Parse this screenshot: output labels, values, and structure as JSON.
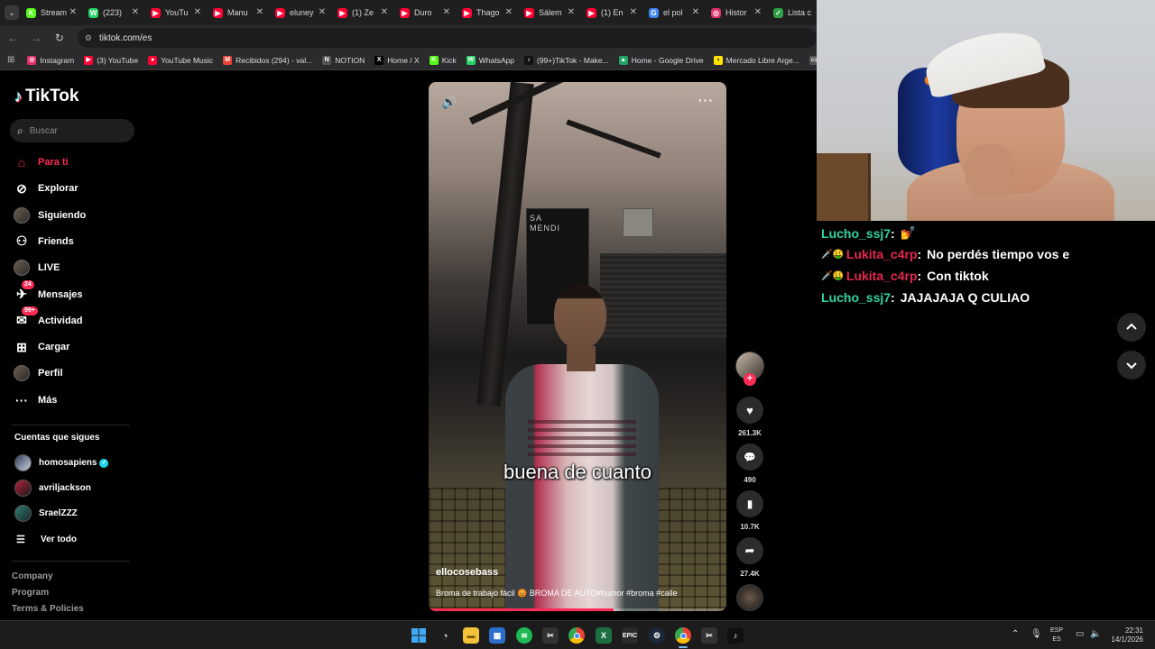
{
  "tabs": [
    {
      "title": "Stream",
      "fav": "K",
      "color": "#53fc18"
    },
    {
      "title": "(223)",
      "fav": "W",
      "color": "#25d366"
    },
    {
      "title": "YouTu",
      "fav": "▶",
      "color": "#ff0033"
    },
    {
      "title": "Manu",
      "fav": "▶",
      "color": "#ff0033"
    },
    {
      "title": "eluney",
      "fav": "▶",
      "color": "#ff0033"
    },
    {
      "title": "(1) Ze",
      "fav": "▶",
      "color": "#ff0033"
    },
    {
      "title": "Duro",
      "fav": "▶",
      "color": "#ff0033"
    },
    {
      "title": "Thago",
      "fav": "▶",
      "color": "#ff0033"
    },
    {
      "title": "Sálem",
      "fav": "▶",
      "color": "#ff0033"
    },
    {
      "title": "(1) En",
      "fav": "▶",
      "color": "#ff0033"
    },
    {
      "title": "el pol",
      "fav": "G",
      "color": "#4285f4"
    },
    {
      "title": "Histor",
      "fav": "◎",
      "color": "#e1306c"
    },
    {
      "title": "Lista c",
      "fav": "✓",
      "color": "#2ea043"
    }
  ],
  "address": {
    "url": "tiktok.com/es"
  },
  "bookmarks": [
    {
      "label": "Instagram",
      "icon": "◎",
      "color": "#e1306c"
    },
    {
      "label": "(3) YouTube",
      "icon": "▶",
      "color": "#ff0033"
    },
    {
      "label": "YouTube Music",
      "icon": "●",
      "color": "#ff0033"
    },
    {
      "label": "Recibidos (294) - val...",
      "icon": "M",
      "color": "#ea4335"
    },
    {
      "label": "NOTION",
      "icon": "N",
      "color": "#555555"
    },
    {
      "label": "Home / X",
      "icon": "X",
      "color": "#000000"
    },
    {
      "label": "Kick",
      "icon": "K",
      "color": "#53fc18"
    },
    {
      "label": "WhatsApp",
      "icon": "W",
      "color": "#25d366"
    },
    {
      "label": "(99+)TikTok - Make...",
      "icon": "♪",
      "color": "#111111"
    },
    {
      "label": "Home - Google Drive",
      "icon": "▲",
      "color": "#1fa463"
    },
    {
      "label": "Mercado Libre Arge...",
      "icon": "◑",
      "color": "#ffe600"
    },
    {
      "label": "PRO",
      "icon": "▭",
      "color": "#555555"
    }
  ],
  "tiktok": {
    "logo": "TikTok",
    "search_placeholder": "Buscar",
    "menu": [
      {
        "label": "Para ti",
        "icon": "home-icon",
        "active": true
      },
      {
        "label": "Explorar",
        "icon": "compass-icon"
      },
      {
        "label": "Siguiendo",
        "icon": "following-icon"
      },
      {
        "label": "Friends",
        "icon": "friends-icon"
      },
      {
        "label": "LIVE",
        "icon": "live-icon"
      },
      {
        "label": "Mensajes",
        "icon": "messages-icon",
        "badge": "24"
      },
      {
        "label": "Actividad",
        "icon": "activity-icon",
        "badge": "99+"
      },
      {
        "label": "Cargar",
        "icon": "upload-icon"
      },
      {
        "label": "Perfil",
        "icon": "profile-icon"
      },
      {
        "label": "Más",
        "icon": "more-icon"
      }
    ],
    "following_title": "Cuentas que sigues",
    "following": [
      {
        "name": "homosapiens",
        "verified": true
      },
      {
        "name": "avriljackson"
      },
      {
        "name": "SraelZZZ"
      }
    ],
    "see_all": "Ver todo",
    "footer": [
      "Company",
      "Program",
      "Terms & Policies"
    ]
  },
  "video": {
    "subtitle": "buena de cuanto",
    "author": "ellocosebass",
    "caption": "Broma de trabajo fácil 😡 BROMA DE AUTO#humor #broma #calle",
    "progress": 0.62,
    "storefront": "SA\nMENDI"
  },
  "actions": {
    "likes": "261.3K",
    "comments": "490",
    "saves": "10.7K",
    "shares": "27.4K"
  },
  "chat": [
    {
      "user": "Lucho_ssj7",
      "color": "#2fd3a0",
      "badges": "",
      "message": "💅"
    },
    {
      "user": "Lukita_c4rp",
      "color": "#e6264f",
      "badges": "🗡️🤑",
      "message": "No perdés tiempo vos e"
    },
    {
      "user": "Lukita_c4rp",
      "color": "#e6264f",
      "badges": "🗡️🤑",
      "message": "Con tiktok"
    },
    {
      "user": "Lucho_ssj7",
      "color": "#2fd3a0",
      "badges": "",
      "message": "JAJAJAJA Q CULIAO"
    }
  ],
  "taskbar": {
    "lang_top": "ESP",
    "lang_bottom": "ES",
    "time": "22:31",
    "date": "14/1/2026"
  }
}
